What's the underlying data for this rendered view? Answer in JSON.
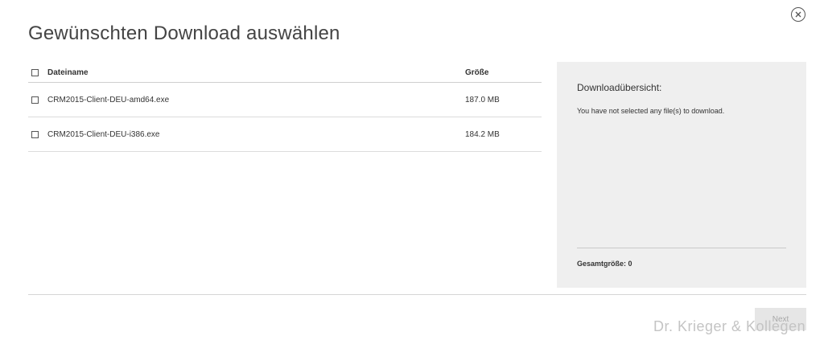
{
  "dialog": {
    "title": "Gewünschten Download auswählen",
    "close_icon": "close-circle-icon"
  },
  "table": {
    "header": {
      "name": "Dateiname",
      "size": "Größe"
    },
    "rows": [
      {
        "name": "CRM2015-Client-DEU-amd64.exe",
        "size": "187.0 MB",
        "checked": false
      },
      {
        "name": "CRM2015-Client-DEU-i386.exe",
        "size": "184.2 MB",
        "checked": false
      }
    ]
  },
  "summary": {
    "title": "Downloadübersicht:",
    "message": "You have not selected any file(s) to download.",
    "total": "Gesamtgröße: 0"
  },
  "footer": {
    "next_label": "Next"
  },
  "watermark": "Dr. Krieger & Kollegen",
  "colors": {
    "panel_bg": "#efefef",
    "button_bg": "#e6e6e6",
    "button_text": "#a8a8a8"
  }
}
